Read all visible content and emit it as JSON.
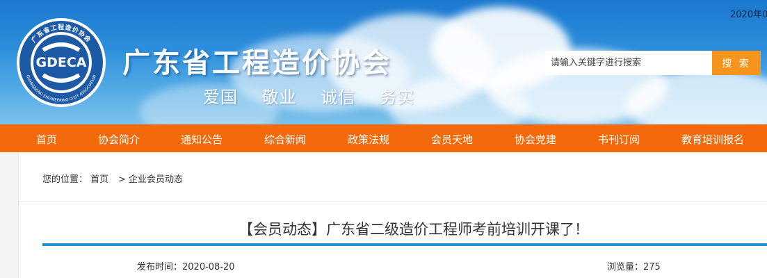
{
  "header": {
    "date_text": "2020年0",
    "logo_text": "GDECA",
    "logo_ring_top": "广东省工程造价协会",
    "logo_ring_bottom": "GUANGDONG ENGINEERING COST ASSOCIATION",
    "site_title": "广东省工程造价协会",
    "slogan": [
      "爱国",
      "敬业",
      "诚信",
      "务实"
    ],
    "search_placeholder": "请输入关键字进行搜索",
    "search_button": "搜 索"
  },
  "nav": {
    "items": [
      {
        "label": "首页"
      },
      {
        "label": "协会简介"
      },
      {
        "label": "通知公告"
      },
      {
        "label": "综合新闻"
      },
      {
        "label": "政策法规"
      },
      {
        "label": "会员天地"
      },
      {
        "label": "协会党建"
      },
      {
        "label": "书刊订阅"
      },
      {
        "label": "教育培训报名"
      }
    ]
  },
  "breadcrumb": {
    "prefix": "您的位置：",
    "home": "首页",
    "separator": ">",
    "current": "企业会员动态"
  },
  "article": {
    "title": "【会员动态】广东省二级造价工程师考前培训开课了！",
    "publish_label": "发布时间：",
    "publish_date": "2020-08-20",
    "views_label": "浏览量：",
    "views": "275"
  },
  "colors": {
    "nav_bg": "#f46a0a",
    "search_button": "#f7941d",
    "accent_bar": "#1b94d8",
    "logo_blue": "#1c5aa6"
  }
}
